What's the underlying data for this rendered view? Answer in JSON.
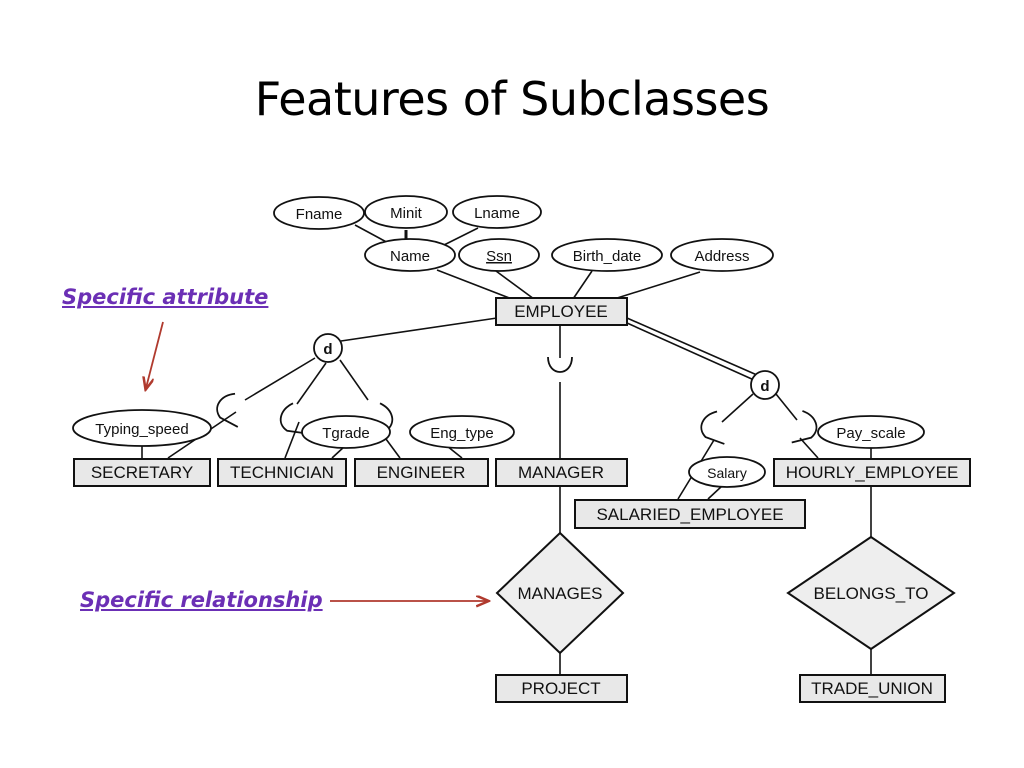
{
  "slide": {
    "title": "Features of Subclasses",
    "background": "#ffffff"
  },
  "annotations": {
    "color": "#6b2fb5",
    "arrow_color": "#b03a2e",
    "specific_attribute": "Specific attribute",
    "specific_relationship": "Specific relationship"
  },
  "diagram": {
    "type": "er-diagram",
    "superclass": {
      "label": "EMPLOYEE"
    },
    "specialization_circles": [
      {
        "label": "d",
        "name": "disjoint-circle-left"
      },
      {
        "label": "d",
        "name": "disjoint-circle-right"
      }
    ],
    "attributes": [
      {
        "label": "Fname",
        "key": false
      },
      {
        "label": "Minit",
        "key": false
      },
      {
        "label": "Lname",
        "key": false
      },
      {
        "label": "Name",
        "key": false
      },
      {
        "label": "Ssn",
        "key": true
      },
      {
        "label": "Birth_date",
        "key": false
      },
      {
        "label": "Address",
        "key": false
      },
      {
        "label": "Typing_speed",
        "key": false
      },
      {
        "label": "Tgrade",
        "key": false
      },
      {
        "label": "Eng_type",
        "key": false
      },
      {
        "label": "Salary",
        "key": false
      },
      {
        "label": "Pay_scale",
        "key": false
      }
    ],
    "subclasses": [
      {
        "label": "SECRETARY"
      },
      {
        "label": "TECHNICIAN"
      },
      {
        "label": "ENGINEER"
      },
      {
        "label": "MANAGER"
      },
      {
        "label": "SALARIED_EMPLOYEE"
      },
      {
        "label": "HOURLY_EMPLOYEE"
      }
    ],
    "relationships": [
      {
        "label": "MANAGES"
      },
      {
        "label": "BELONGS_TO"
      }
    ],
    "related_entities": [
      {
        "label": "PROJECT"
      },
      {
        "label": "TRADE_UNION"
      }
    ],
    "style": {
      "entity_fill": "#e8e8e8",
      "entity_stroke": "#000000",
      "ellipse_fill": "#ffffff",
      "diamond_fill": "#eeeeee"
    }
  }
}
